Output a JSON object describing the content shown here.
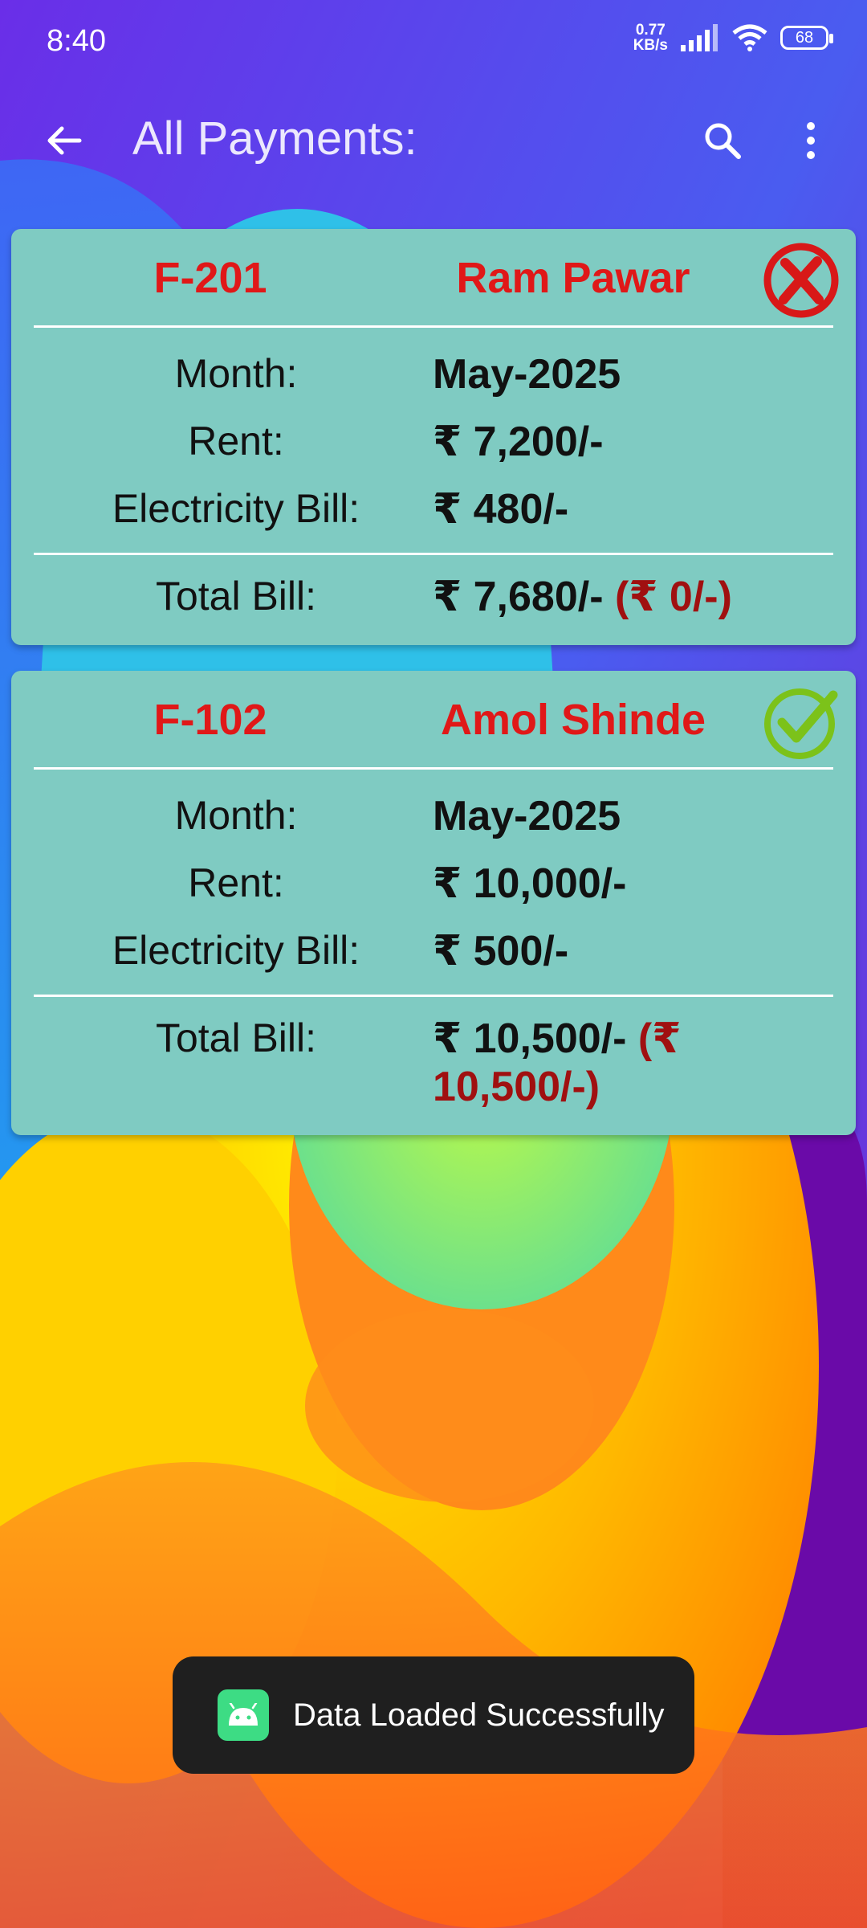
{
  "status_bar": {
    "time": "8:40",
    "net_speed_value": "0.77",
    "net_speed_unit": "KB/s",
    "battery": "68",
    "icons": [
      "signal-icon",
      "wifi-icon",
      "battery-icon"
    ]
  },
  "toolbar": {
    "title": "All Payments:",
    "back_icon": "arrow-back-icon",
    "search_icon": "search-icon",
    "more_icon": "more-vert-icon"
  },
  "labels": {
    "month": "Month:",
    "rent": "Rent:",
    "electricity": "Electricity Bill:",
    "total": "Total Bill:"
  },
  "payments": [
    {
      "flat": "F-201",
      "tenant": "Ram Pawar",
      "month": "May-2025",
      "rent": "₹ 7,200/-",
      "electricity": "₹ 480/-",
      "total": "₹ 7,680/-",
      "pending": "(₹ 0/-)",
      "status_icon": "unpaid-cross-icon"
    },
    {
      "flat": "F-102",
      "tenant": "Amol Shinde",
      "month": "May-2025",
      "rent": "₹ 10,000/-",
      "electricity": "₹ 500/-",
      "total": "₹ 10,500/-",
      "pending": "(₹ 10,500/-)",
      "status_icon": "paid-check-icon"
    }
  ],
  "toast": {
    "text": "Data Loaded Successfully",
    "icon": "android-app-icon"
  },
  "colors": {
    "card_bg": "#7fcbc2",
    "name_red": "#e01818",
    "pending_red": "#a01010",
    "toast_bg": "#1f1f1f"
  }
}
